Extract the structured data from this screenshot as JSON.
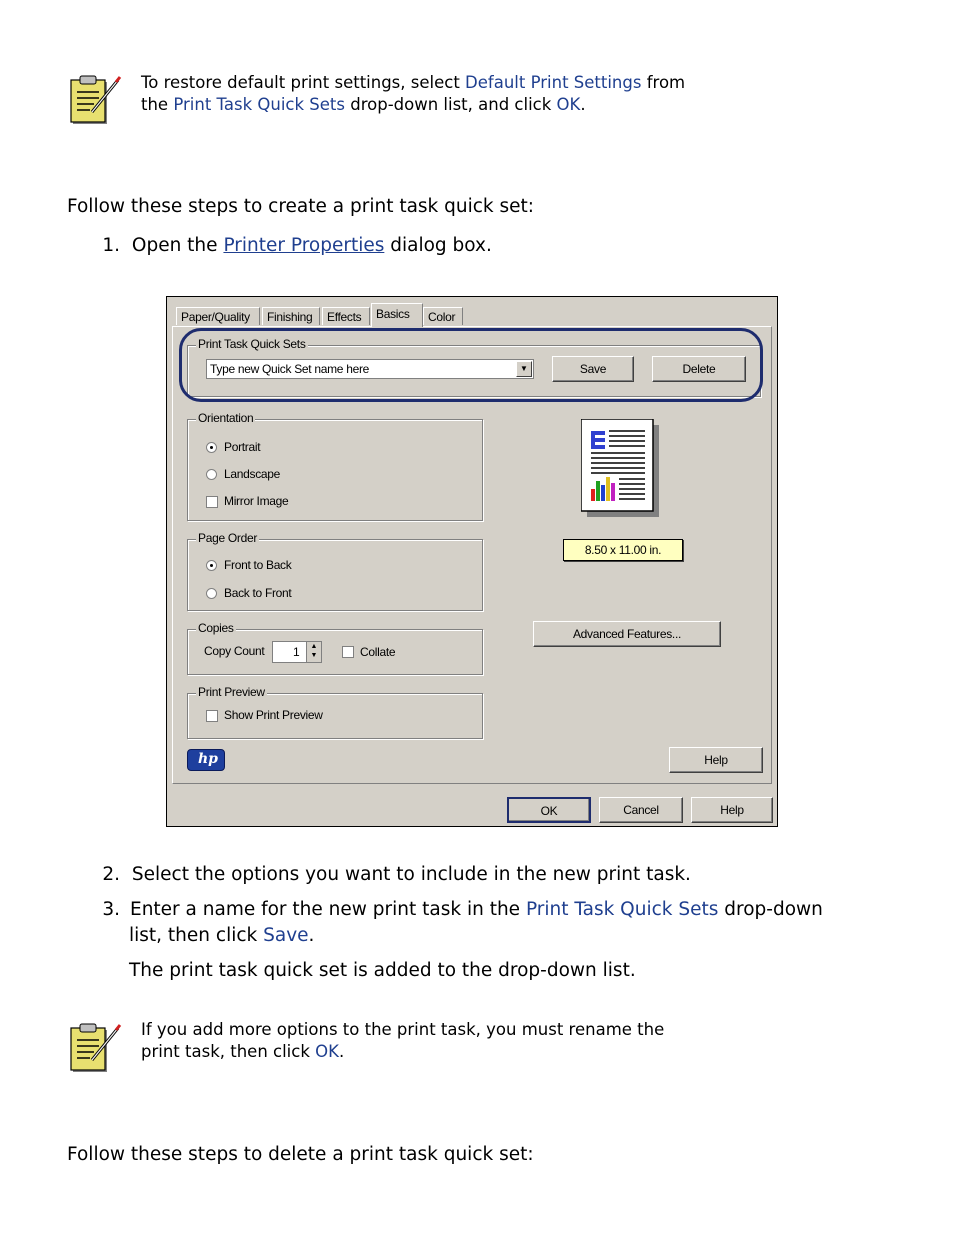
{
  "note1": {
    "icon": "note-icon",
    "t1": "To restore default print settings, select ",
    "h1": "Default Print Settings",
    "t2": " from",
    "t3": "the ",
    "h2": "Print Task Quick Sets",
    "t4": " drop-down list, and click ",
    "h3": "OK",
    "t5": "."
  },
  "intro_create": "Follow these steps to create a print task quick set:",
  "step1": {
    "num": "1.",
    "pre": "Open the ",
    "link": "Printer Properties",
    "post": " dialog box."
  },
  "dialog": {
    "tabs": [
      "Paper/Quality",
      "Finishing",
      "Effects",
      "Basics",
      "Color"
    ],
    "active_tab": "Basics",
    "quick_sets": {
      "label": "Print Task Quick Sets",
      "input_value": "Type new Quick Set name here",
      "save": "Save",
      "delete": "Delete"
    },
    "orientation": {
      "label": "Orientation",
      "portrait": "Portrait",
      "landscape": "Landscape",
      "mirror": "Mirror Image"
    },
    "page_order": {
      "label": "Page Order",
      "front": "Front to Back",
      "back": "Back to Front"
    },
    "copies": {
      "label": "Copies",
      "count_label": "Copy Count",
      "count_value": "1",
      "collate": "Collate"
    },
    "print_preview": {
      "label": "Print Preview",
      "show": "Show Print Preview"
    },
    "paper_size": "8.50 x 11.00 in.",
    "advanced": "Advanced Features...",
    "help_inner": "Help",
    "ok": "OK",
    "cancel": "Cancel",
    "help": "Help",
    "logo": "hp",
    "colors": {
      "highlight_ring": "#1e2c6e",
      "size_badge": "#ffffc0"
    }
  },
  "step2": {
    "num": "2.",
    "text": "Select the options you want to include in the new print task."
  },
  "step3": {
    "num": "3.",
    "t1": "Enter a name for the new print task in the ",
    "h1": "Print Task Quick Sets",
    "t2": " drop-down",
    "t3": "list, then click ",
    "h2": "Save",
    "t4": "."
  },
  "step3_result": "The print task quick set is added to the drop-down list.",
  "note2": {
    "icon": "note-icon",
    "t1": "If you add more options to the print task, you must rename the",
    "t2": "print task, then click ",
    "h1": "OK",
    "t3": "."
  },
  "intro_delete": "Follow these steps to delete a print task quick set:"
}
